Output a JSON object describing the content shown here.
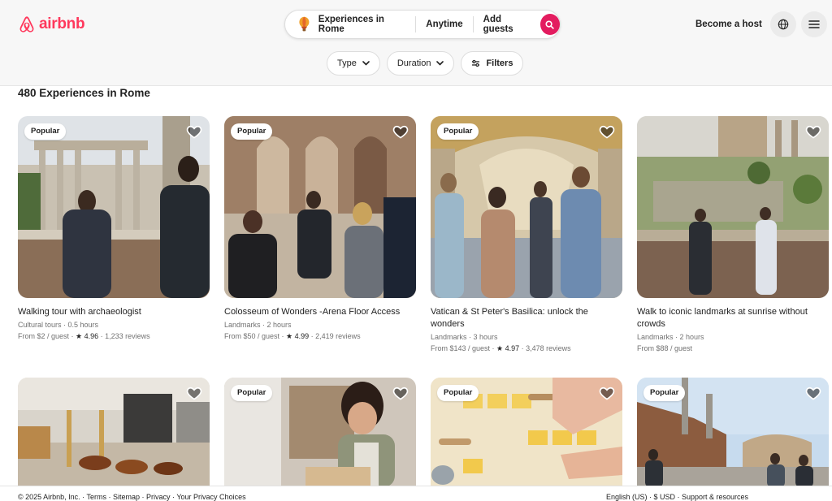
{
  "brand": {
    "name": "airbnb",
    "color": "#FF385C"
  },
  "search": {
    "where": "Experiences in Rome",
    "when": "Anytime",
    "who": "Add guests",
    "icon": "search-icon"
  },
  "header": {
    "become_host": "Become a host",
    "globe_icon": "globe-icon",
    "menu_icon": "menu-icon"
  },
  "filters": [
    {
      "label": "Type",
      "icon": "chevron-down-icon"
    },
    {
      "label": "Duration",
      "icon": "chevron-down-icon"
    },
    {
      "label": "Filters",
      "icon": "sliders-icon"
    }
  ],
  "results_title": "480 Experiences in Rome",
  "cards": [
    {
      "badge": "Popular",
      "title": "Walking tour with archaeologist",
      "sub": "Cultural tours · 0.5 hours",
      "price": "From $2 / guest",
      "rating": "★ 4.96",
      "reviews": "1,233 reviews"
    },
    {
      "badge": "Popular",
      "title": "Colosseum of Wonders -Arena Floor Access",
      "sub": "Landmarks · 2 hours",
      "price": "From $50 / guest",
      "rating": "★ 4.99",
      "reviews": "2,419 reviews"
    },
    {
      "badge": "Popular",
      "title": "Vatican & St Peter's Basilica: unlock the wonders",
      "sub": "Landmarks · 3 hours",
      "price": "From $143 / guest",
      "rating": "★ 4.97",
      "reviews": "3,478 reviews"
    },
    {
      "badge": "",
      "title": "Walk to iconic landmarks at sunrise without crowds",
      "sub": "Landmarks · 2 hours",
      "price": "From $88 / guest",
      "rating": "",
      "reviews": ""
    },
    {
      "badge": ""
    },
    {
      "badge": "Popular"
    },
    {
      "badge": "Popular"
    },
    {
      "badge": "Popular"
    }
  ],
  "footer": {
    "left": "© 2025 Airbnb, Inc. · Terms · Sitemap · Privacy · Your Privacy Choices",
    "right": "English (US) · $ USD · Support & resources"
  }
}
